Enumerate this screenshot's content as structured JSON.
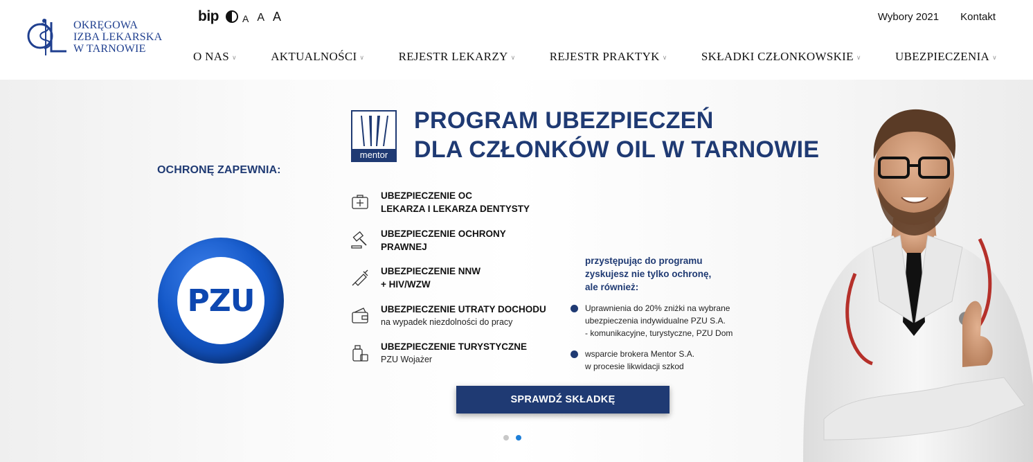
{
  "header": {
    "logo_lines": [
      "OKRĘGOWA",
      "IZBA LEKARSKA",
      "W TARNOWIE"
    ],
    "utility": {
      "bip": "bip",
      "font_small": "A",
      "font_medium": "A",
      "font_large": "A"
    },
    "top_links": [
      "Wybory 2021",
      "Kontakt"
    ],
    "nav": [
      {
        "label": "O NAS"
      },
      {
        "label": "AKTUALNOŚCI"
      },
      {
        "label": "REJESTR LEKARZY"
      },
      {
        "label": "REJESTR PRAKTYK"
      },
      {
        "label": "SKŁADKI CZŁONKOWSKIE"
      },
      {
        "label": "UBEZPIECZENIA"
      }
    ]
  },
  "hero": {
    "protection_label": "OCHRONĘ ZAPEWNIA:",
    "pzu_logo_text": "PZU",
    "mentor_logo_text": "mentor",
    "title_lines": [
      "PROGRAM UBEZPIECZEŃ",
      "DLA CZŁONKÓW OIL W TARNOWIE"
    ],
    "insurances": [
      {
        "icon": "medical-case-icon",
        "line1": "UBEZPIECZENIE OC",
        "line2": "LEKARZA I LEKARZA DENTYSTY",
        "line2_bold": true
      },
      {
        "icon": "gavel-icon",
        "line1": "UBEZPIECZENIE OCHRONY",
        "line2": "PRAWNEJ",
        "line2_bold": true
      },
      {
        "icon": "syringe-icon",
        "line1": "UBEZPIECZENIE NNW",
        "line2": "+ HIV/WZW",
        "line2_bold": true
      },
      {
        "icon": "wallet-icon",
        "line1": "UBEZPIECZENIE UTRATY DOCHODU",
        "line2": "na wypadek niezdolności do pracy",
        "line2_bold": false
      },
      {
        "icon": "luggage-icon",
        "line1": "UBEZPIECZENIE TURYSTYCZNE",
        "line2": "PZU Wojażer",
        "line2_bold": false
      }
    ],
    "bonus_intro": [
      "przystępując do programu",
      "zyskujesz nie tylko ochronę,",
      "ale również:"
    ],
    "bonus_points": [
      [
        "Uprawnienia do 20% zniżki na wybrane",
        "ubezpieczenia indywidualne PZU S.A.",
        "- komunikacyjne, turystyczne, PZU Dom"
      ],
      [
        "wsparcie brokera Mentor S.A.",
        "w procesie likwidacji szkod"
      ]
    ],
    "cta_label": "SPRAWDŹ SKŁADKĘ",
    "carousel": {
      "slides": 2,
      "active": 2
    }
  },
  "colors": {
    "brand_navy": "#1f3a73",
    "logo_blue": "#1f3f8f",
    "pzu_blue": "#1458c8",
    "dot_active": "#1e7fd8"
  }
}
